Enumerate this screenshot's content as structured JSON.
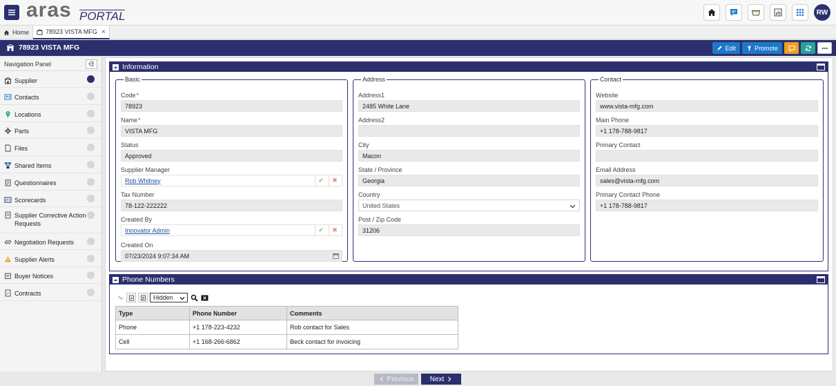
{
  "header": {
    "logo_main": "aras",
    "logo_sub": "PORTAL",
    "avatar_initials": "RW"
  },
  "tabs": [
    {
      "label": "Home"
    },
    {
      "label": "78923 VISTA MFG"
    }
  ],
  "item_bar": {
    "title": "78923 VISTA MFG",
    "edit_label": "Edit",
    "promote_label": "Promote"
  },
  "nav": {
    "title": "Navigation Panel",
    "items": [
      {
        "label": "Supplier",
        "icon": "supplier-icon",
        "active": true
      },
      {
        "label": "Contacts",
        "icon": "contacts-icon"
      },
      {
        "label": "Locations",
        "icon": "location-pin-icon"
      },
      {
        "label": "Parts",
        "icon": "gear-icon"
      },
      {
        "label": "Files",
        "icon": "file-icon"
      },
      {
        "label": "Shared Items",
        "icon": "shared-items-icon"
      },
      {
        "label": "Questionnaires",
        "icon": "questionnaire-icon"
      },
      {
        "label": "Scorecards",
        "icon": "scorecard-icon"
      },
      {
        "label": "Supplier Corrective Action Requests",
        "icon": "corrective-action-icon"
      },
      {
        "label": "Negotiation Requests",
        "icon": "negotiation-icon"
      },
      {
        "label": "Supplier Alerts",
        "icon": "alert-icon"
      },
      {
        "label": "Buyer Notices",
        "icon": "notice-icon"
      },
      {
        "label": "Contracts",
        "icon": "contract-icon"
      }
    ]
  },
  "information": {
    "title": "Information",
    "basic": {
      "legend": "Basic",
      "code_label": "Code",
      "code": "78923",
      "name_label": "Name",
      "name": "VISTA MFG",
      "status_label": "Status",
      "status": "Approved",
      "manager_label": "Supplier Manager",
      "manager": "Rob Whitney",
      "tax_label": "Tax Number",
      "tax": "78-122-222222",
      "created_by_label": "Created By",
      "created_by": "Innovator Admin",
      "created_on_label": "Created On",
      "created_on": "07/23/2024 9:07:34 AM"
    },
    "address": {
      "legend": "Address",
      "address1_label": "Address1",
      "address1": "2485 White Lane",
      "address2_label": "Address2",
      "address2": "",
      "city_label": "City",
      "city": "Macon",
      "state_label": "State / Province",
      "state": "Georgia",
      "country_label": "Country",
      "country": "United States",
      "zip_label": "Post / Zip Code",
      "zip": "31206"
    },
    "contact": {
      "legend": "Contact",
      "website_label": "Website",
      "website": "www.vista-mfg.com",
      "main_phone_label": "Main Phone",
      "main_phone": "+1 178-788-9817",
      "primary_contact_label": "Primary Contact",
      "primary_contact": "",
      "email_label": "Email Address",
      "email": "sales@vista-mfg.com",
      "primary_phone_label": "Primary Contact Phone",
      "primary_phone": "+1 178-788-9817"
    }
  },
  "phone_numbers": {
    "title": "Phone Numbers",
    "filter_value": "Hidden",
    "columns": [
      "Type",
      "Phone Number",
      "Comments"
    ],
    "rows": [
      [
        "Phone",
        "+1 178-223-4232",
        "Rob contact for Sales"
      ],
      [
        "Cell",
        "+1 168-266-6862",
        "Beck contact for invoicing"
      ]
    ]
  },
  "footer": {
    "previous_label": "Previous",
    "next_label": "Next"
  },
  "colors": {
    "brand": "#2b2f6e",
    "edit_button": "#1e78c8",
    "discussion_button": "#f0a020",
    "refresh_button": "#2aa198"
  }
}
